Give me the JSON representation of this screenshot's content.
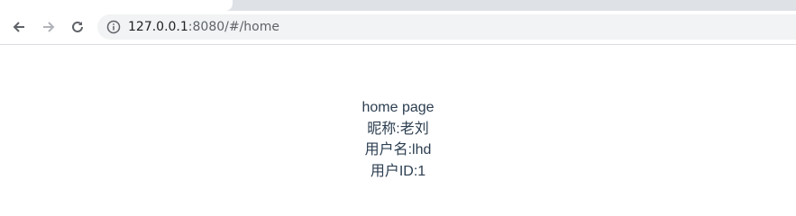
{
  "browser": {
    "tab_title": "",
    "url_host": "127.0.0.1",
    "url_rest": ":8080/#/home"
  },
  "icons": {
    "back": "arrow-left-icon",
    "forward": "arrow-right-icon",
    "reload": "reload-icon",
    "site_info": "info-icon"
  },
  "colors": {
    "text": "#2c3e50",
    "toolbar_icon": "#5f6368",
    "disabled_icon": "#b0b3b8",
    "omnibox_bg": "#f1f3f4"
  },
  "page": {
    "heading": "home page",
    "nickname_line": "昵称:老刘",
    "username_line": "用户名:lhd",
    "userid_line": "用户ID:1"
  }
}
